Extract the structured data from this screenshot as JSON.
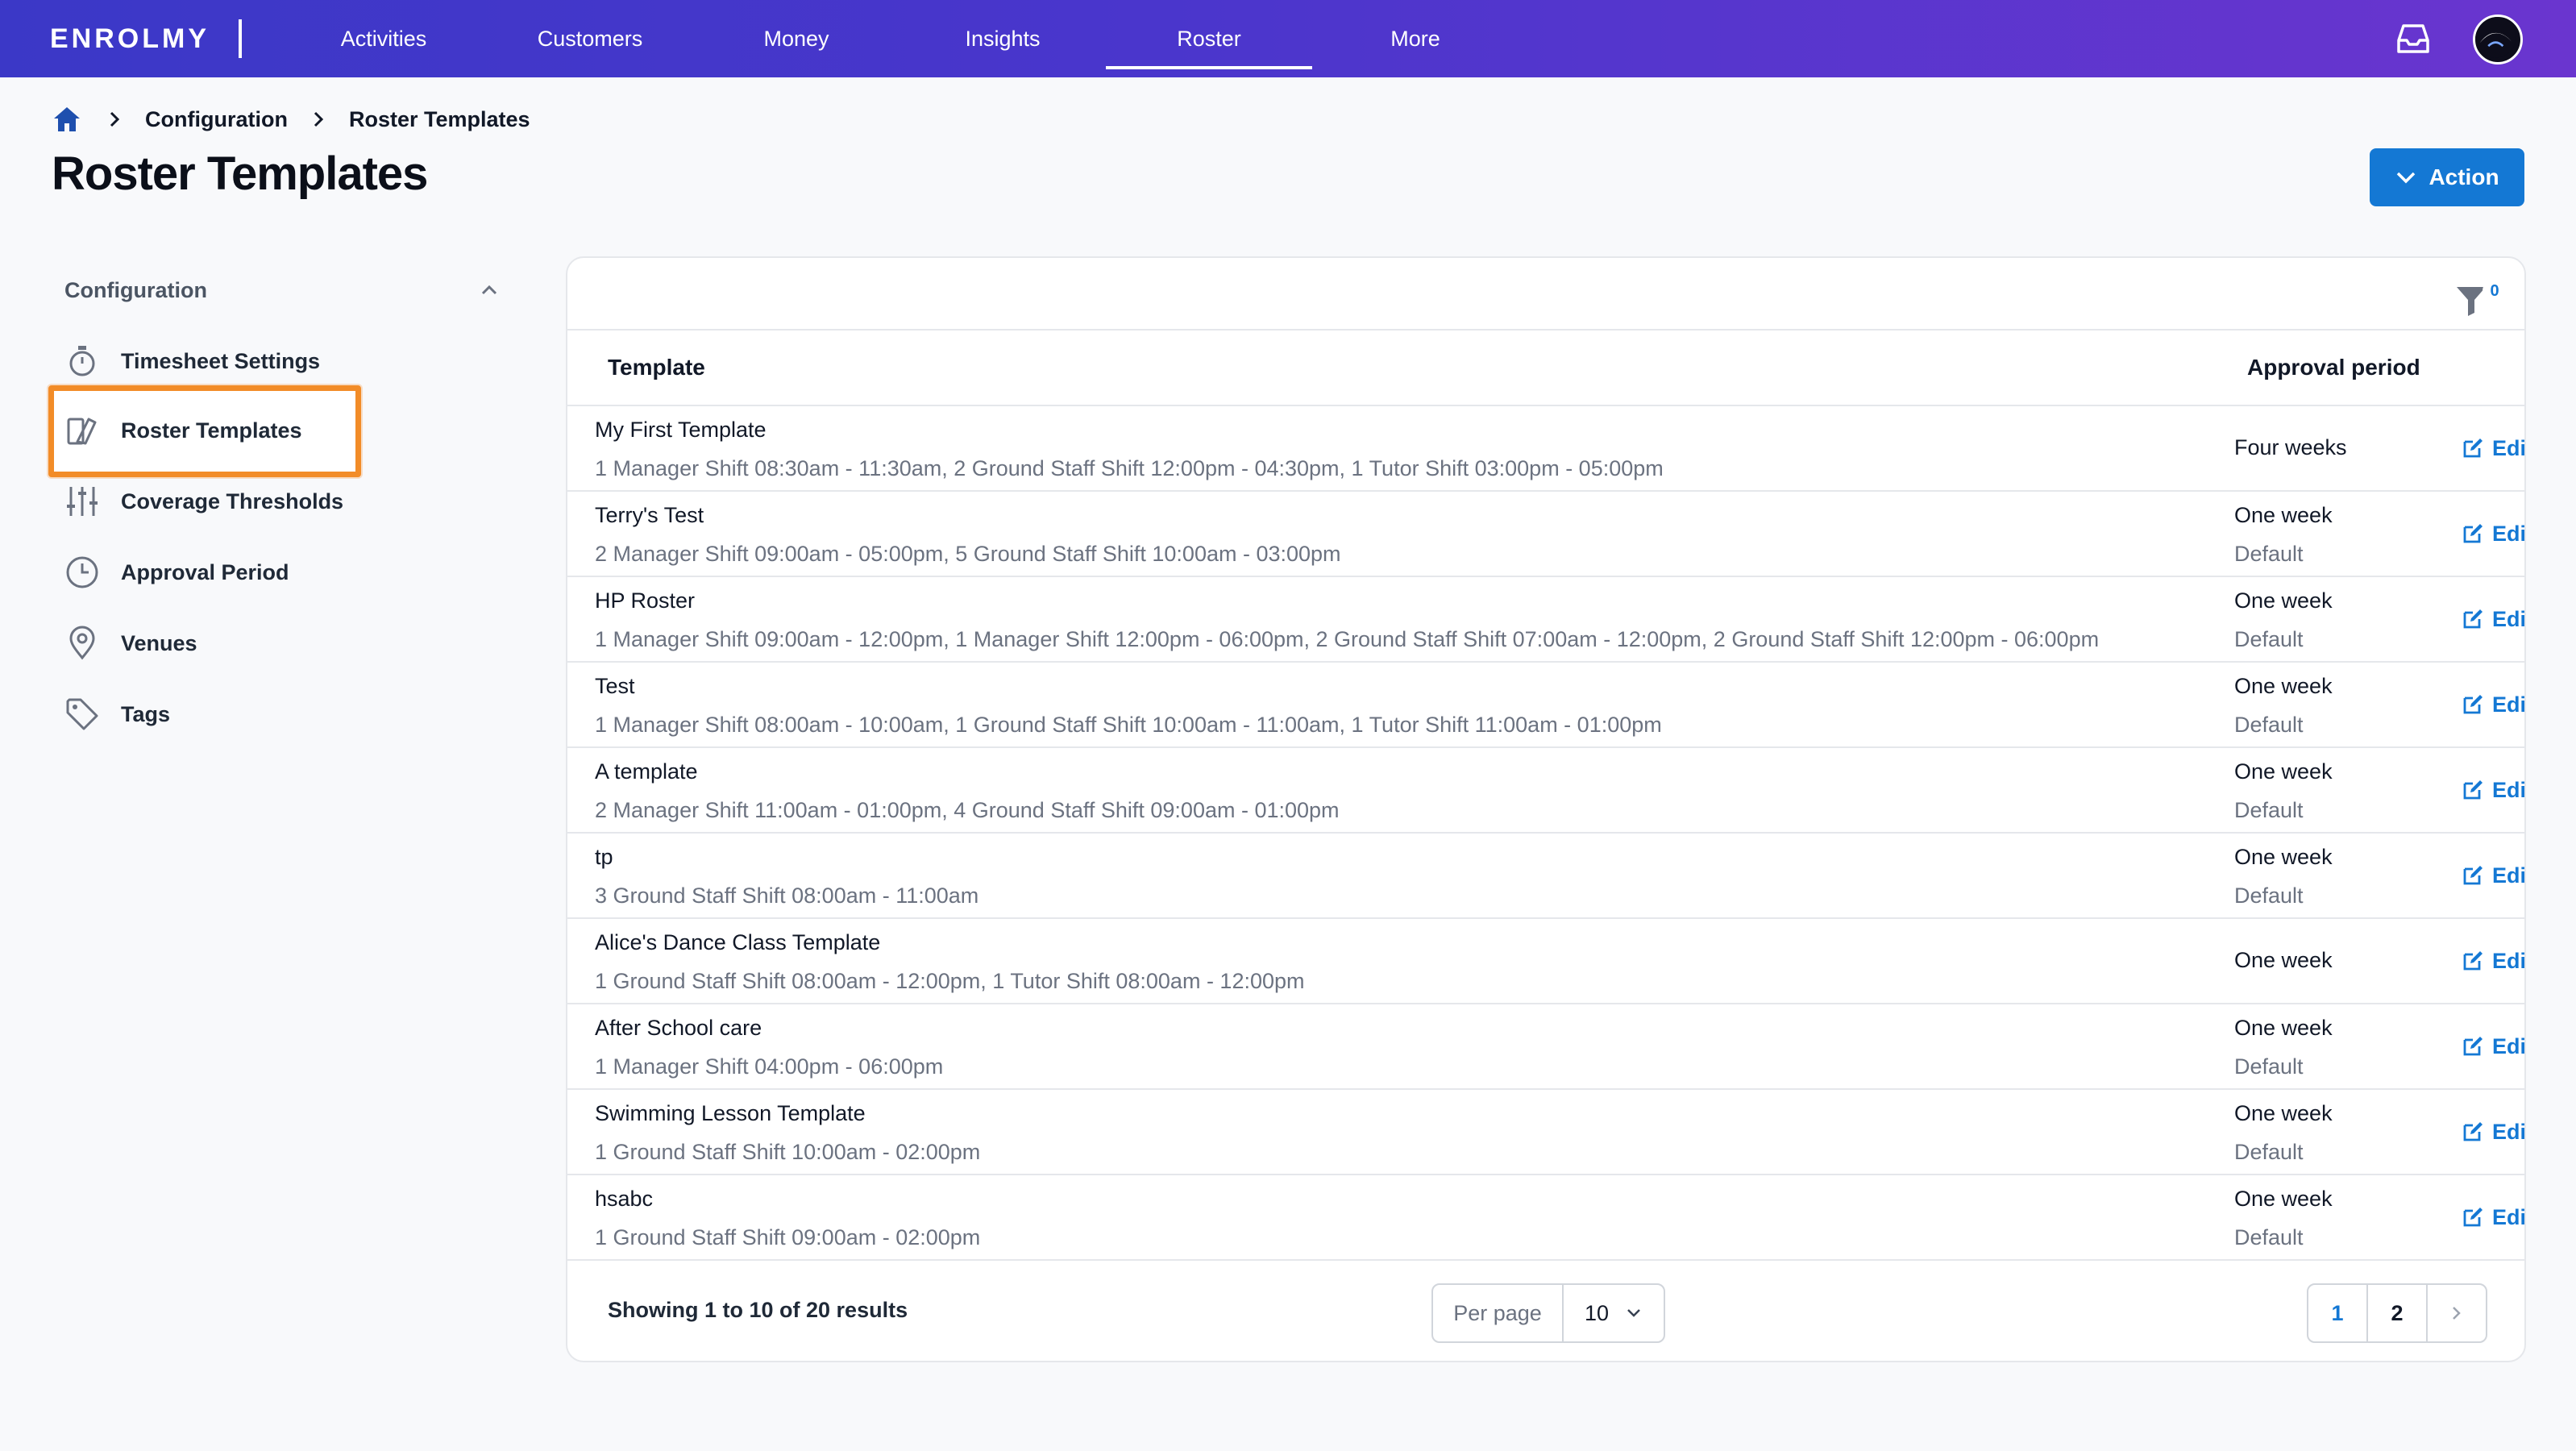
{
  "nav": {
    "logo": "ENROLMY",
    "items": [
      "Activities",
      "Customers",
      "Money",
      "Insights",
      "Roster",
      "More"
    ],
    "active": "Roster"
  },
  "breadcrumb": [
    "Configuration",
    "Roster Templates"
  ],
  "page_title": "Roster Templates",
  "action_label": "Action",
  "sidebar": {
    "header": "Configuration",
    "items": [
      {
        "label": "Timesheet Settings",
        "icon": "stopwatch-icon"
      },
      {
        "label": "Roster Templates",
        "icon": "template-icon"
      },
      {
        "label": "Coverage Thresholds",
        "icon": "sliders-icon"
      },
      {
        "label": "Approval Period",
        "icon": "clock-icon"
      },
      {
        "label": "Venues",
        "icon": "map-pin-icon"
      },
      {
        "label": "Tags",
        "icon": "tag-icon"
      }
    ],
    "highlighted": "Roster Templates"
  },
  "filter_count": "0",
  "table": {
    "headers": {
      "template": "Template",
      "approval": "Approval period"
    },
    "edit_label": "Edi",
    "rows": [
      {
        "name": "My First Template",
        "desc": "1 Manager Shift 08:30am - 11:30am, 2 Ground Staff Shift 12:00pm - 04:30pm, 1 Tutor Shift 03:00pm - 05:00pm",
        "period": "Four weeks",
        "default": ""
      },
      {
        "name": "Terry's Test",
        "desc": "2 Manager Shift 09:00am - 05:00pm, 5 Ground Staff Shift 10:00am - 03:00pm",
        "period": "One week",
        "default": "Default"
      },
      {
        "name": "HP Roster",
        "desc": "1 Manager Shift 09:00am - 12:00pm, 1 Manager Shift 12:00pm - 06:00pm, 2 Ground Staff Shift 07:00am - 12:00pm, 2 Ground Staff Shift 12:00pm - 06:00pm",
        "period": "One week",
        "default": "Default"
      },
      {
        "name": "Test",
        "desc": "1 Manager Shift 08:00am - 10:00am, 1 Ground Staff Shift 10:00am - 11:00am, 1 Tutor Shift 11:00am - 01:00pm",
        "period": "One week",
        "default": "Default"
      },
      {
        "name": "A template",
        "desc": "2 Manager Shift 11:00am - 01:00pm, 4 Ground Staff Shift 09:00am - 01:00pm",
        "period": "One week",
        "default": "Default"
      },
      {
        "name": "tp",
        "desc": "3 Ground Staff Shift 08:00am - 11:00am",
        "period": "One week",
        "default": "Default"
      },
      {
        "name": "Alice's Dance Class Template",
        "desc": "1 Ground Staff Shift 08:00am - 12:00pm, 1 Tutor Shift 08:00am - 12:00pm",
        "period": "One week",
        "default": ""
      },
      {
        "name": "After School care",
        "desc": "1 Manager Shift 04:00pm - 06:00pm",
        "period": "One week",
        "default": "Default"
      },
      {
        "name": "Swimming Lesson Template",
        "desc": "1 Ground Staff Shift 10:00am - 02:00pm",
        "period": "One week",
        "default": "Default"
      },
      {
        "name": "hsabc",
        "desc": "1 Ground Staff Shift 09:00am - 02:00pm",
        "period": "One week",
        "default": "Default"
      }
    ]
  },
  "footer": {
    "showing": "Showing 1 to 10 of 20 results",
    "per_page_label": "Per page",
    "per_page_value": "10",
    "pages": [
      "1",
      "2"
    ],
    "current_page": "1"
  },
  "colors": {
    "nav_start": "#3b38c7",
    "nav_end": "#6a35cf",
    "accent": "#1478d4",
    "highlight": "#f28c28"
  }
}
